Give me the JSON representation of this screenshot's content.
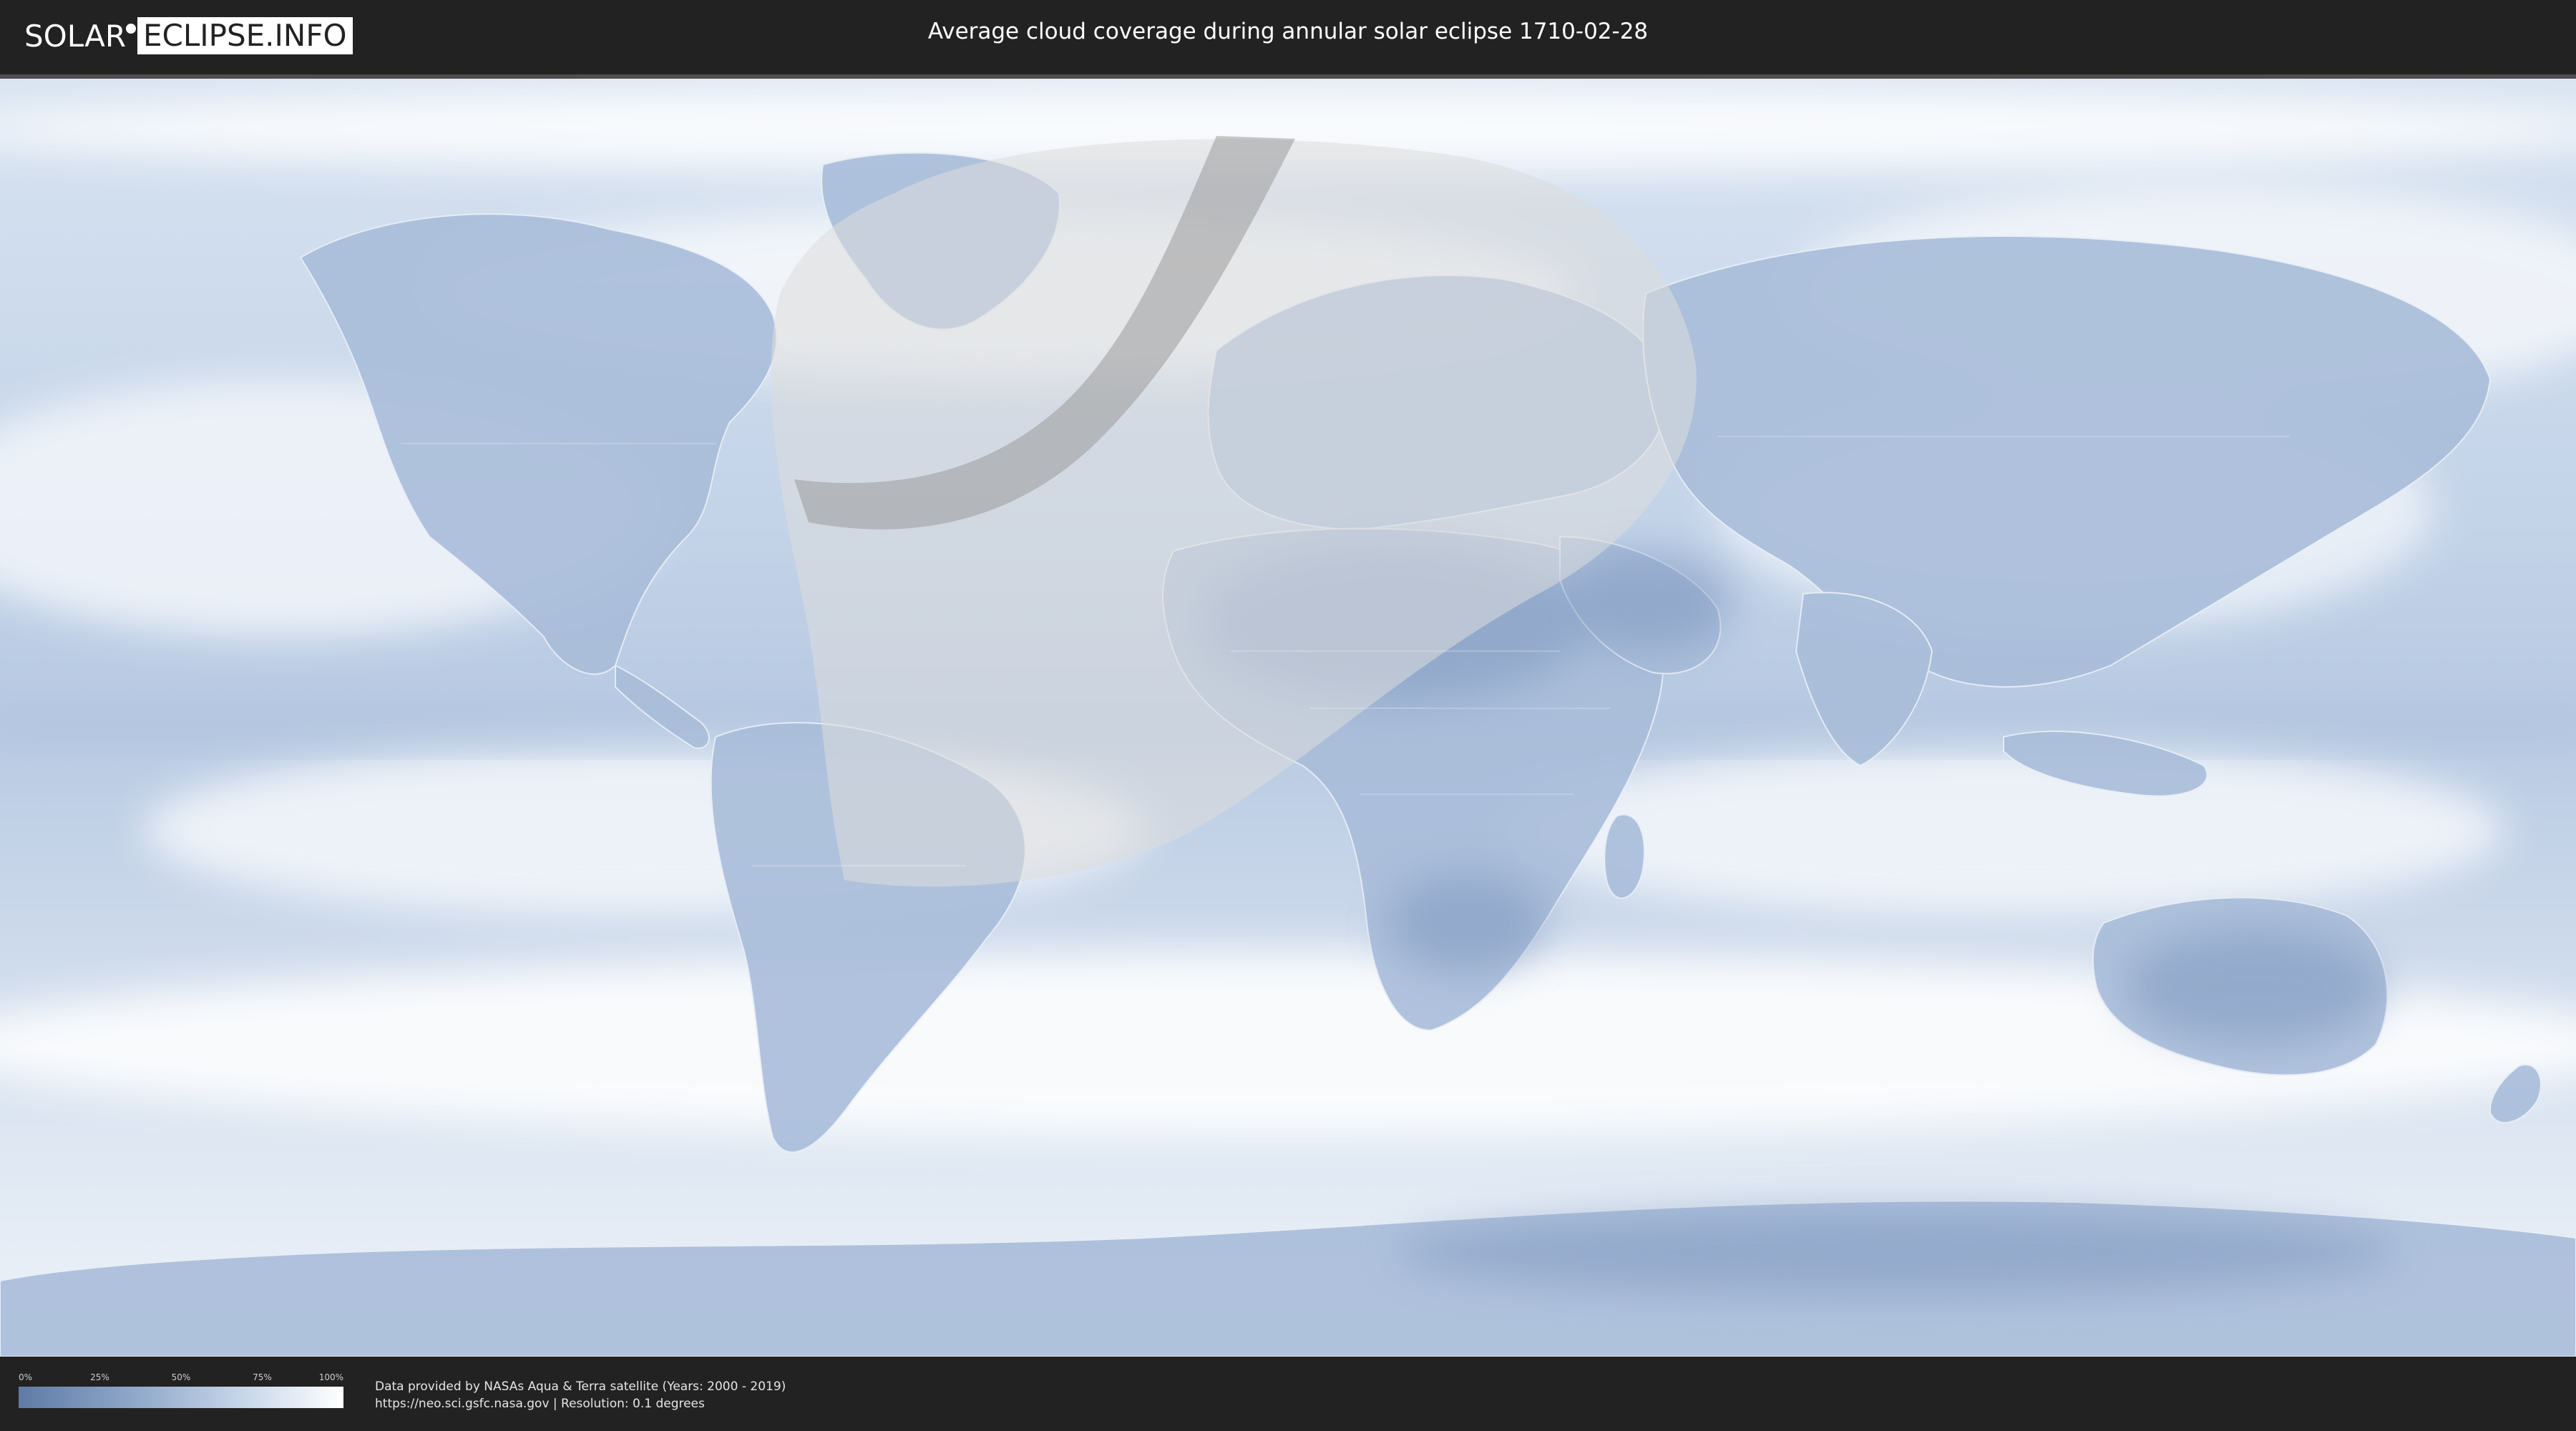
{
  "header": {
    "logo_left": "SOLAR",
    "logo_right": "ECLIPSE.INFO",
    "title": "Average cloud coverage during annular solar eclipse 1710-02-28"
  },
  "map": {
    "ocean_color": "#c7d6e9",
    "land_color": "#9fb6d6",
    "cloud_color": "#ffffff",
    "penumbra_color": "#d9d9d9",
    "path_color": "#9c9c9c"
  },
  "legend": {
    "ticks": [
      "0%",
      "25%",
      "50%",
      "75%",
      "100%"
    ],
    "low_color": "#5f7aa6",
    "high_color": "#ffffff"
  },
  "credits": {
    "line1": "Data provided by NASAs Aqua & Terra satellite (Years: 2000 - 2019)",
    "line2": "https://neo.sci.gsfc.nasa.gov | Resolution: 0.1 degrees"
  }
}
